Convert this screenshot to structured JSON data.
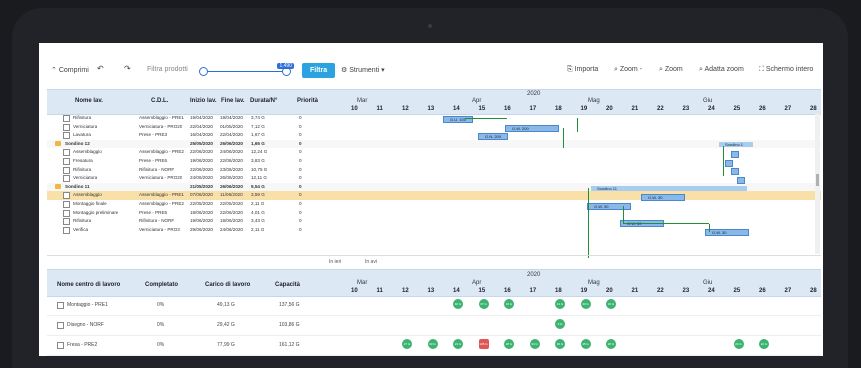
{
  "toolbar": {
    "collapse_label": "Comprimi",
    "filter_placeholder": "Filtra prodotti",
    "slider_value": "1.490",
    "filter_button": "Filtra",
    "tools_label": "Strumenti",
    "import_label": "Importa",
    "zoom_minus_label": "Zoom -",
    "zoom_plus_label": "Zoom",
    "fit_label": "Adatta zoom",
    "fullscreen_label": "Schermo intero"
  },
  "grid": {
    "columns": [
      "Nome lav.",
      "C.D.L.",
      "Inizio lav.",
      "Fine lav.",
      "Durata/N°",
      "Priorità"
    ],
    "year": "2020",
    "months": [
      "Mar",
      "Apr",
      "Mag",
      "Giu"
    ],
    "days": [
      "10",
      "11",
      "12",
      "13",
      "14",
      "15",
      "16",
      "17",
      "18",
      "19",
      "20",
      "21",
      "22",
      "23",
      "24",
      "25",
      "26",
      "27",
      "28"
    ],
    "rows": [
      {
        "name": "Rifinitura",
        "cdl": "Assemblaggio - PRE1",
        "start": "19/04/2020",
        "end": "19/04/2020",
        "dur": "3,74 G",
        "prio": "0",
        "type": "child"
      },
      {
        "name": "Verniciatura",
        "cdl": "Verniciatura - PRO20",
        "start": "22/04/2020",
        "end": "01/05/2020",
        "dur": "7,12 G",
        "prio": "0",
        "type": "child"
      },
      {
        "name": "Lavatura",
        "cdl": "Prese - PRE3",
        "start": "16/04/2020",
        "end": "22/04/2020",
        "dur": "1,67 G",
        "prio": "0",
        "type": "child"
      },
      {
        "name": "Sondino 12",
        "cdl": "",
        "start": "25/05/2020",
        "end": "26/06/2020",
        "dur": "1,65 G",
        "prio": "0",
        "type": "parent"
      },
      {
        "name": "Assemblaggio",
        "cdl": "Assemblaggio - PRE2",
        "start": "22/06/2020",
        "end": "24/06/2020",
        "dur": "12,24 G",
        "prio": "0",
        "type": "child"
      },
      {
        "name": "Fresatura",
        "cdl": "Prese - PRE6",
        "start": "19/06/2020",
        "end": "22/06/2020",
        "dur": "3,83 G",
        "prio": "0",
        "type": "child"
      },
      {
        "name": "Rifinitura",
        "cdl": "Rifinitura - NORF",
        "start": "22/06/2020",
        "end": "23/06/2020",
        "dur": "10,75 G",
        "prio": "0",
        "type": "child"
      },
      {
        "name": "Verniciatura",
        "cdl": "Verniciatura - PRO20",
        "start": "24/06/2020",
        "end": "26/06/2020",
        "dur": "12,11 G",
        "prio": "0",
        "type": "child"
      },
      {
        "name": "Sondino 11",
        "cdl": "",
        "start": "21/05/2020",
        "end": "26/06/2020",
        "dur": "9,54 G",
        "prio": "0",
        "type": "parent"
      },
      {
        "name": "Assemblaggio",
        "cdl": "Assemblaggio - PRE1",
        "start": "07/06/2020",
        "end": "11/06/2020",
        "dur": "3,59 G",
        "prio": "0",
        "type": "selected"
      },
      {
        "name": "Montaggio finale",
        "cdl": "Assemblaggio - PRE2",
        "start": "22/05/2020",
        "end": "22/05/2020",
        "dur": "2,11 G",
        "prio": "0",
        "type": "child"
      },
      {
        "name": "Montaggio preliminare",
        "cdl": "Prese - PRE5",
        "start": "18/06/2020",
        "end": "22/06/2020",
        "dur": "4,01 G",
        "prio": "0",
        "type": "child"
      },
      {
        "name": "Rifinitura",
        "cdl": "Rifinitura - NORF",
        "start": "19/06/2020",
        "end": "19/06/2020",
        "dur": "3,43 G",
        "prio": "0",
        "type": "child"
      },
      {
        "name": "Verifica",
        "cdl": "Verniciatura - PRO3",
        "start": "29/06/2020",
        "end": "24/06/2020",
        "dur": "2,11 G",
        "prio": "0",
        "type": "child"
      }
    ],
    "bars": {
      "b1": "G.U. 100",
      "b2": "G.W. 200",
      "b3": "G.N. 200",
      "sum1": "Sondino 1",
      "sum2": "Sondino 11",
      "b4": "G.W. 30",
      "b5": "G.W. 30",
      "b6": "G.W. 30",
      "b7": "G.W. 30"
    }
  },
  "mid": {
    "left": "In ieri",
    "right": "In avi"
  },
  "load": {
    "columns": [
      "Nome centro di lavoro",
      "Completato",
      "Carico di lavoro",
      "Capacità"
    ],
    "rows": [
      {
        "name": "Montaggio - PRE1",
        "done": "0%",
        "load": "49,13 G",
        "cap": "137,56 G"
      },
      {
        "name": "Disegno - NORF",
        "done": "0%",
        "load": "29,42 G",
        "cap": "103,86 G"
      },
      {
        "name": "Fresa - PRE2",
        "done": "0%",
        "load": "77,99 G",
        "cap": "161,12 G"
      }
    ],
    "row1_cells": [
      "40 G",
      "37 G",
      "34 G",
      "41 G",
      "33 G",
      "34 G"
    ],
    "row2_cells": [
      "9 G"
    ],
    "row3_cells": [
      "27 G",
      "33 G",
      "24 G",
      "105 G",
      "28 G",
      "34 G",
      "30 G",
      "45 G",
      "28 G",
      "24 G",
      "22 G"
    ]
  }
}
